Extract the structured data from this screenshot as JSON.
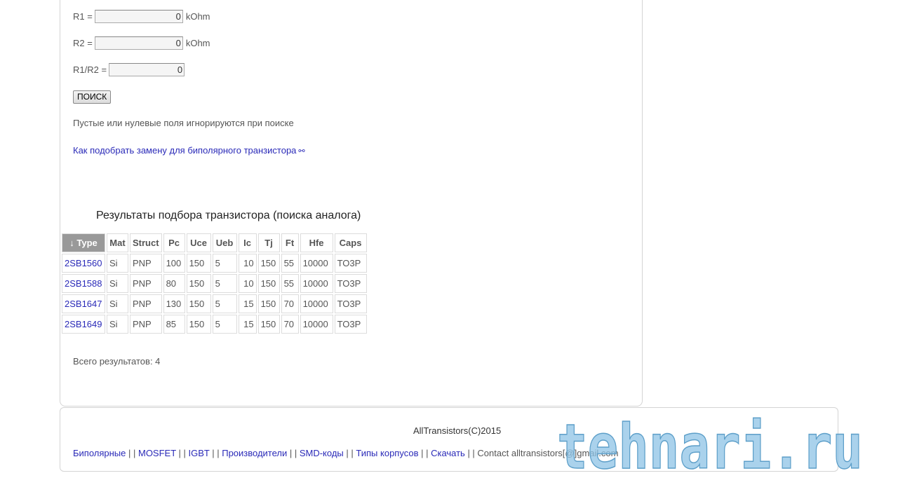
{
  "form": {
    "r1": {
      "label": "R1 =",
      "value": "0",
      "unit": "kOhm"
    },
    "r2": {
      "label": "R2 =",
      "value": "0",
      "unit": "kOhm"
    },
    "ratio": {
      "label": "R1/R2 =",
      "value": "0"
    },
    "search_button": "ПОИСК",
    "note": "Пустые или нулевые поля игнорируются при поиске",
    "howto_link": "Как подобрать замену для биполярного транзистора",
    "howto_icon": "⚯"
  },
  "results": {
    "title": "Результаты подбора транзистора (поиска аналога)",
    "columns": [
      "↓ Type",
      "Mat",
      "Struct",
      "Pc",
      "Uce",
      "Ueb",
      "Ic",
      "Tj",
      "Ft",
      "Hfe",
      "Caps"
    ],
    "rows": [
      [
        "2SB1560",
        "Si",
        "PNP",
        "100",
        "150",
        "5",
        "10",
        "150",
        "55",
        "10000",
        "TO3P"
      ],
      [
        "2SB1588",
        "Si",
        "PNP",
        "80",
        "150",
        "5",
        "10",
        "150",
        "55",
        "10000",
        "TO3P"
      ],
      [
        "2SB1647",
        "Si",
        "PNP",
        "130",
        "150",
        "5",
        "15",
        "150",
        "70",
        "10000",
        "TO3P"
      ],
      [
        "2SB1649",
        "Si",
        "PNP",
        "85",
        "150",
        "5",
        "15",
        "150",
        "70",
        "10000",
        "TO3P"
      ]
    ],
    "total": "Всего результатов: 4"
  },
  "footer": {
    "copyright": "AllTransistors(C)2015",
    "links": [
      "Биполярные",
      "MOSFET",
      "IGBT",
      "Производители",
      "SMD-коды",
      "Типы корпусов",
      "Скачать"
    ],
    "separator": " | | ",
    "contact": "Contact alltransistors[@]gmail.com"
  },
  "watermark": {
    "text": "tehnari.ru",
    "color": "#8ec3e6"
  },
  "colors": {
    "link": "#2a2ab8",
    "sorted_header": "#999999",
    "border": "#d4d4d4"
  }
}
